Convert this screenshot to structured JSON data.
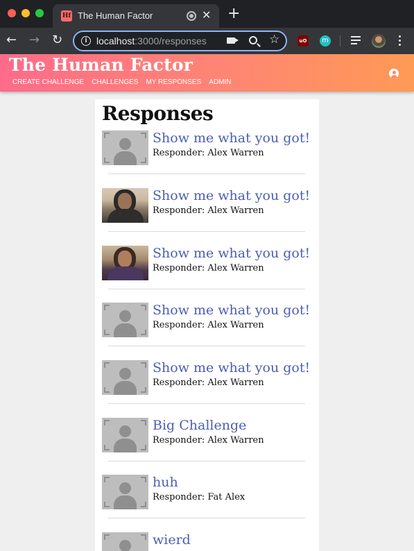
{
  "browser": {
    "tab_title": "The Human Factor",
    "favicon_text": "Hf",
    "new_tab_label": "+",
    "url_host": "localhost",
    "url_path": ":3000/responses",
    "ext_ublock_label": "uO",
    "ext_m_label": "m"
  },
  "app": {
    "title": "The Human Factor",
    "nav": [
      "CREATE CHALLENGE",
      "CHALLENGES",
      "MY RESPONSES",
      "ADMIN"
    ]
  },
  "page": {
    "heading": "Responses"
  },
  "responses": [
    {
      "title": "Show me what you got!",
      "responder": "Responder: Alex Warren",
      "thumbnail": "placeholder"
    },
    {
      "title": "Show me what you got!",
      "responder": "Responder: Alex Warren",
      "thumbnail": "photo"
    },
    {
      "title": "Show me what you got!",
      "responder": "Responder: Alex Warren",
      "thumbnail": "photo"
    },
    {
      "title": "Show me what you got!",
      "responder": "Responder: Alex Warren",
      "thumbnail": "placeholder"
    },
    {
      "title": "Show me what you got!",
      "responder": "Responder: Alex Warren",
      "thumbnail": "placeholder"
    },
    {
      "title": "Big Challenge",
      "responder": "Responder: Alex Warren",
      "thumbnail": "placeholder"
    },
    {
      "title": "huh",
      "responder": "Responder: Fat Alex",
      "thumbnail": "placeholder"
    },
    {
      "title": "wierd",
      "responder": "",
      "thumbnail": "placeholder"
    }
  ],
  "colors": {
    "accent_start": "#fd6b8a",
    "accent_end": "#ff9a55",
    "link": "#4d5fb0"
  }
}
